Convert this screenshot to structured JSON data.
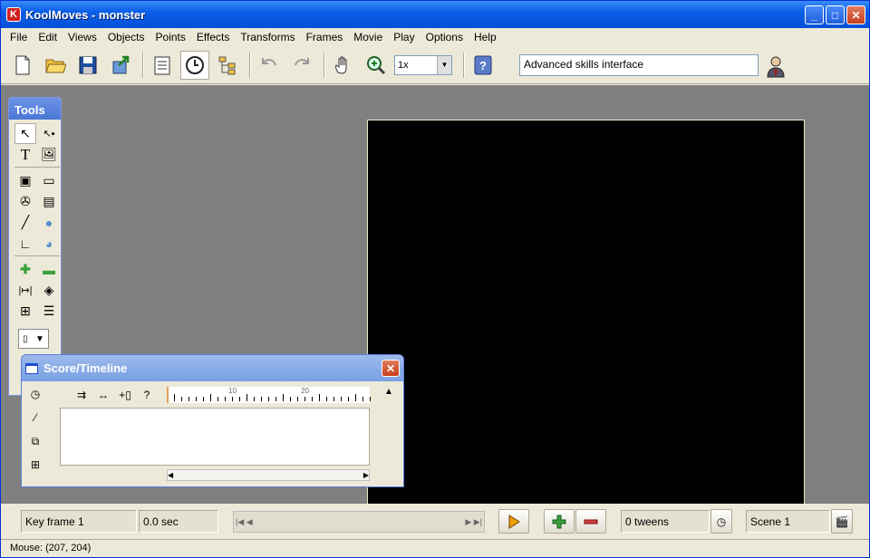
{
  "window": {
    "title": "KoolMoves - monster",
    "app_icon_letter": "K"
  },
  "menubar": {
    "items": [
      "File",
      "Edit",
      "Views",
      "Objects",
      "Points",
      "Effects",
      "Transforms",
      "Frames",
      "Movie",
      "Play",
      "Options",
      "Help"
    ]
  },
  "toolbar": {
    "zoom_value": "1x",
    "interface_mode": "Advanced skills interface"
  },
  "tools_panel": {
    "title": "Tools"
  },
  "timeline": {
    "title": "Score/Timeline",
    "ruler_labels": [
      "10",
      "20"
    ]
  },
  "statusbar": {
    "key_frame": "Key frame 1",
    "time": "0.0 sec",
    "tweens": "0 tweens",
    "scene": "Scene 1"
  },
  "bottom_status": {
    "mouse": "Mouse: (207, 204)"
  },
  "colors": {
    "stage": "#000000",
    "workspace": "#808080",
    "titlebar": "#0a5ee8",
    "play_icon": "#f0a000",
    "add_icon": "#3aa03a",
    "remove_icon": "#d04040"
  }
}
